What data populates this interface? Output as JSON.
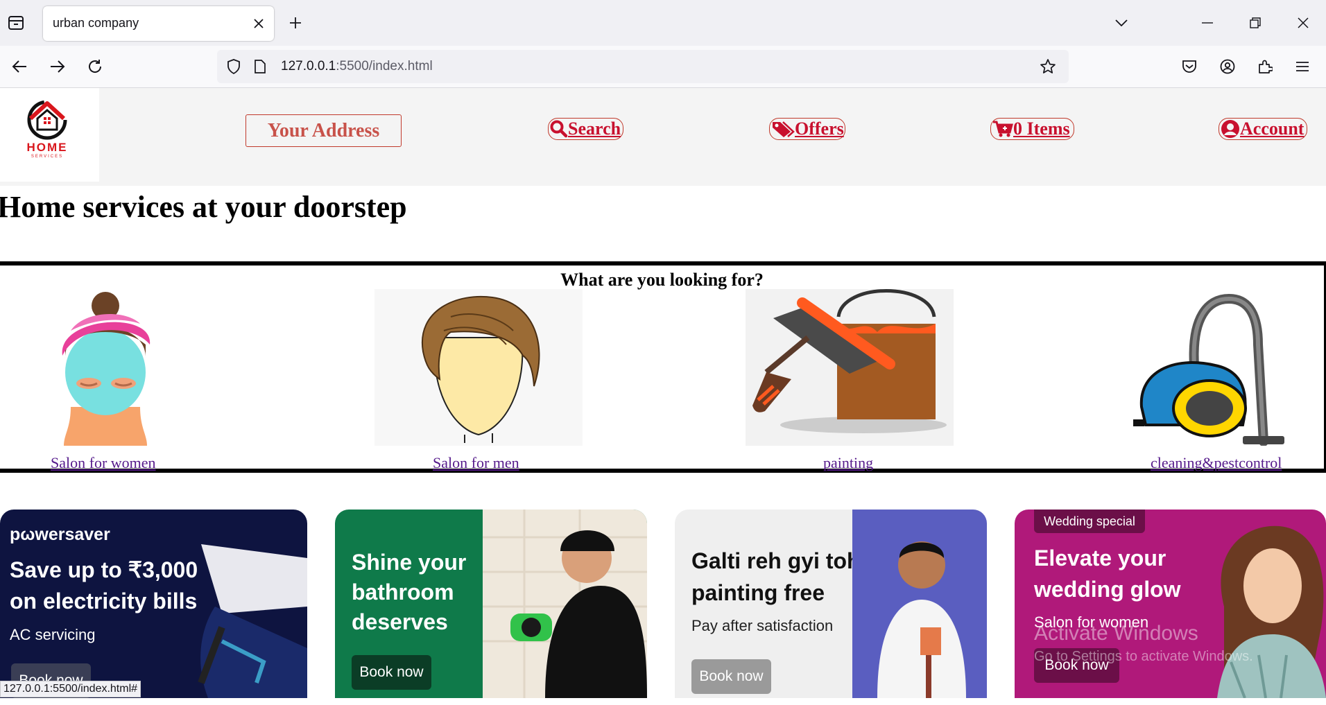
{
  "browser": {
    "tab_title": "urban company",
    "url_host": "127.0.0.1",
    "url_rest": ":5500/index.html",
    "status_url": "127.0.0.1:5500/index.html#"
  },
  "header": {
    "logo_text": "HOME",
    "logo_sub": "SERVICES",
    "address_label": "Your Address",
    "search_label": "Search",
    "offers_label": "Offers",
    "cart_label": "0 Items",
    "account_label": "Account"
  },
  "headline": "Home services at your doorstep",
  "services": {
    "title": "What are you looking for?",
    "items": [
      {
        "label": "Salon for women",
        "icon": "woman-facial-icon"
      },
      {
        "label": "Salon for men",
        "icon": "man-hair-icon"
      },
      {
        "label": "painting",
        "icon": "paint-roller-icon"
      },
      {
        "label": "cleaning&pestcontrol",
        "icon": "vacuum-cleaner-icon"
      }
    ]
  },
  "promos": [
    {
      "brand": "pωwersaver",
      "title_line1": "Save up to ₹3,000",
      "title_line2": "on electricity bills",
      "subtitle": "AC servicing",
      "button": "Book now",
      "bg": "#0e1440"
    },
    {
      "title_line1": "Shine your",
      "title_line2": "bathroom",
      "title_line3": "deserves",
      "button": "Book now",
      "bg": "#0f7a4a"
    },
    {
      "title_line1": "Galti reh gyi toh",
      "title_line2": "painting free",
      "subtitle": "Pay after satisfaction",
      "button": "Book now",
      "bg": "#efefef"
    },
    {
      "badge": "Wedding special",
      "title_line1": "Elevate your",
      "title_line2": "wedding glow",
      "subtitle": "Salon for women",
      "button": "Book now",
      "bg": "#b0197a"
    }
  ],
  "watermark": {
    "line1": "Activate Windows",
    "line2": "Go to Settings to activate Windows."
  },
  "colors": {
    "brand_red": "#c8102e",
    "link_visited": "#551a8b"
  }
}
